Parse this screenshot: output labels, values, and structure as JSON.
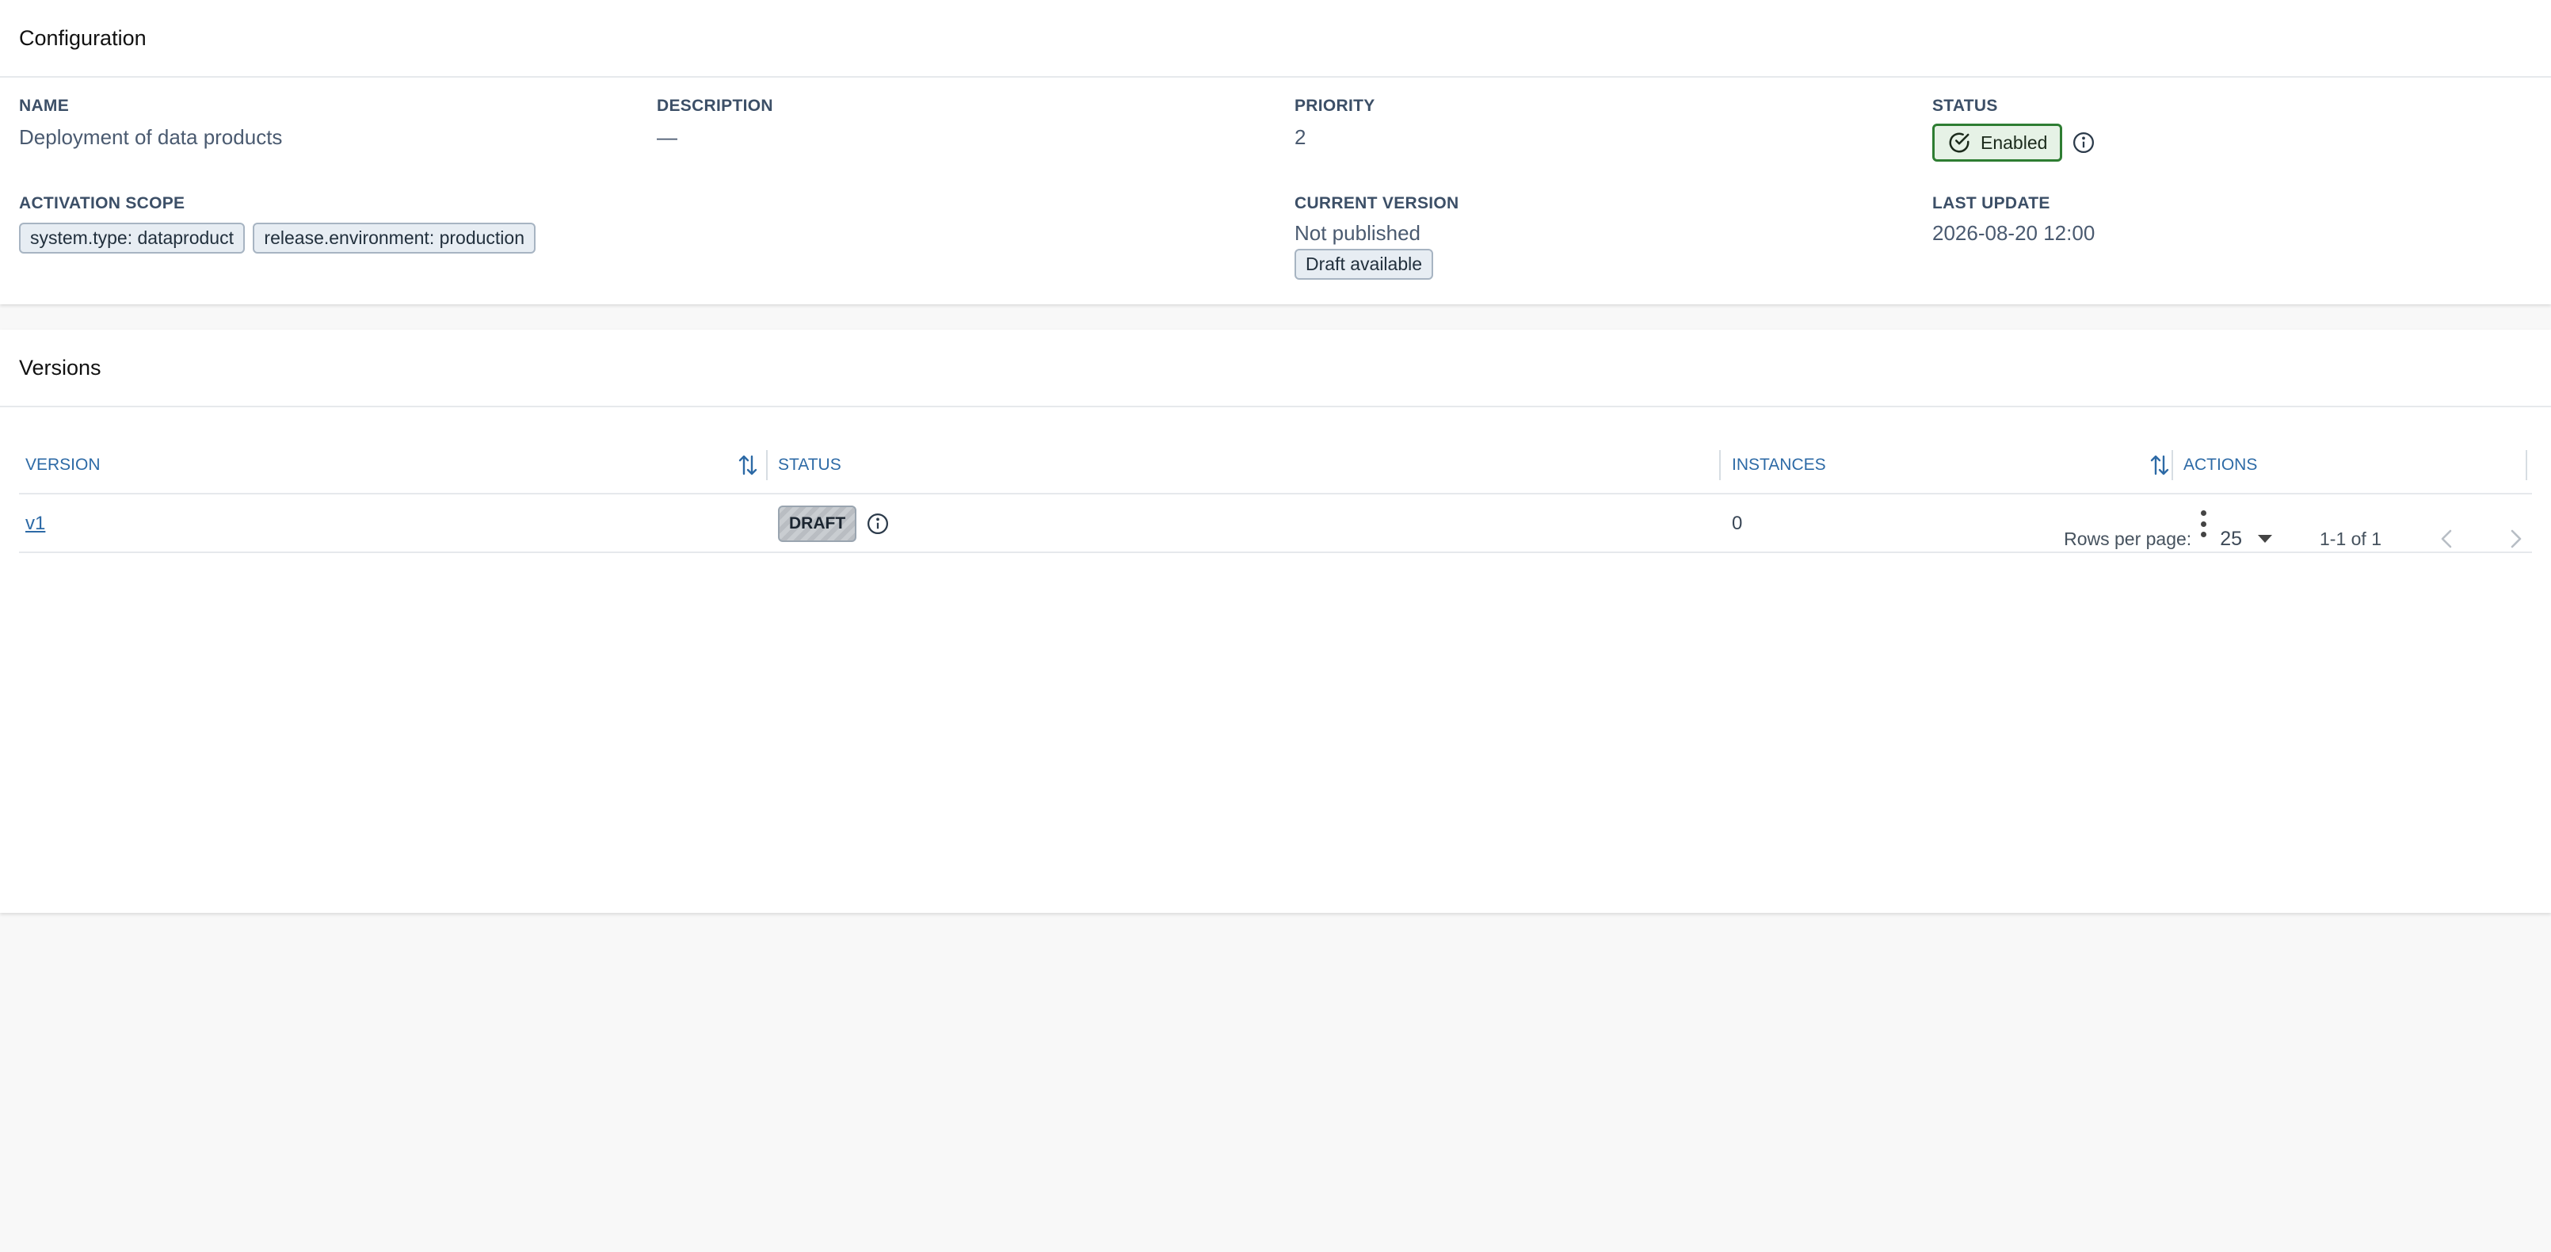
{
  "configuration": {
    "title": "Configuration",
    "name": {
      "label": "NAME",
      "value": "Deployment of data products"
    },
    "description": {
      "label": "DESCRIPTION",
      "value": "—"
    },
    "priority": {
      "label": "PRIORITY",
      "value": "2"
    },
    "status": {
      "label": "STATUS",
      "value": "Enabled",
      "color": "#2e7d32"
    },
    "activation_scope": {
      "label": "ACTIVATION SCOPE",
      "chips": [
        "system.type: dataproduct",
        "release.environment: production"
      ]
    },
    "current_version": {
      "label": "CURRENT VERSION",
      "value": "Not published",
      "badge": "Draft available"
    },
    "last_update": {
      "label": "LAST UPDATE",
      "value": "2026-08-20 12:00"
    }
  },
  "versions": {
    "title": "Versions",
    "columns": [
      "VERSION",
      "STATUS",
      "INSTANCES",
      "ACTIONS"
    ],
    "rows": [
      {
        "version": "v1",
        "status": "DRAFT",
        "instances": "0"
      }
    ],
    "pagination": {
      "rows_per_page_label": "Rows per page:",
      "rows_per_page": "25",
      "range": "1-1 of 1"
    }
  },
  "colors": {
    "accent": "#2d6aa6",
    "enabled_green": "#2e7d32"
  }
}
